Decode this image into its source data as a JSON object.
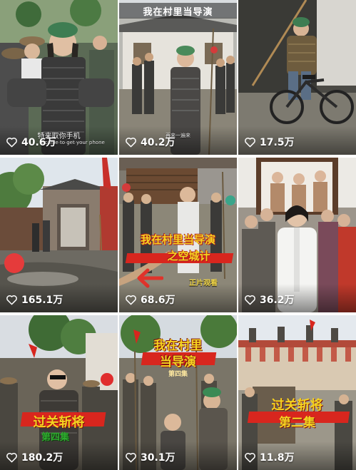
{
  "tiles": [
    {
      "likes": "40.6万",
      "subtitle": "特来取你手机",
      "subtitle2": "I came to get your phone"
    },
    {
      "likes": "40.2万",
      "banner": "我在村里当导演",
      "subtitle": "再来一遍来"
    },
    {
      "likes": "17.5万"
    },
    {
      "likes": "165.1万"
    },
    {
      "likes": "68.6万",
      "title_line1": "我在村里当导演",
      "title_line2": "之空城计",
      "watch_label": "正片观看"
    },
    {
      "likes": "36.2万"
    },
    {
      "likes": "180.2万",
      "title_main": "过关斩将",
      "episode": "第四集"
    },
    {
      "likes": "30.1万",
      "title_line1": "我在村里",
      "title_line2": "当导演",
      "episode": "第四集"
    },
    {
      "likes": "11.8万",
      "title_main": "过关斩将",
      "episode": "第二集"
    }
  ],
  "colors": {
    "like_text": "#ffffff",
    "banner_red": "#d8261e",
    "title_yellow": "#f5d420",
    "episode_green": "#2faa2f"
  },
  "icons": {
    "like": "heart-outline-icon",
    "arrow": "arrow-left-icon"
  }
}
